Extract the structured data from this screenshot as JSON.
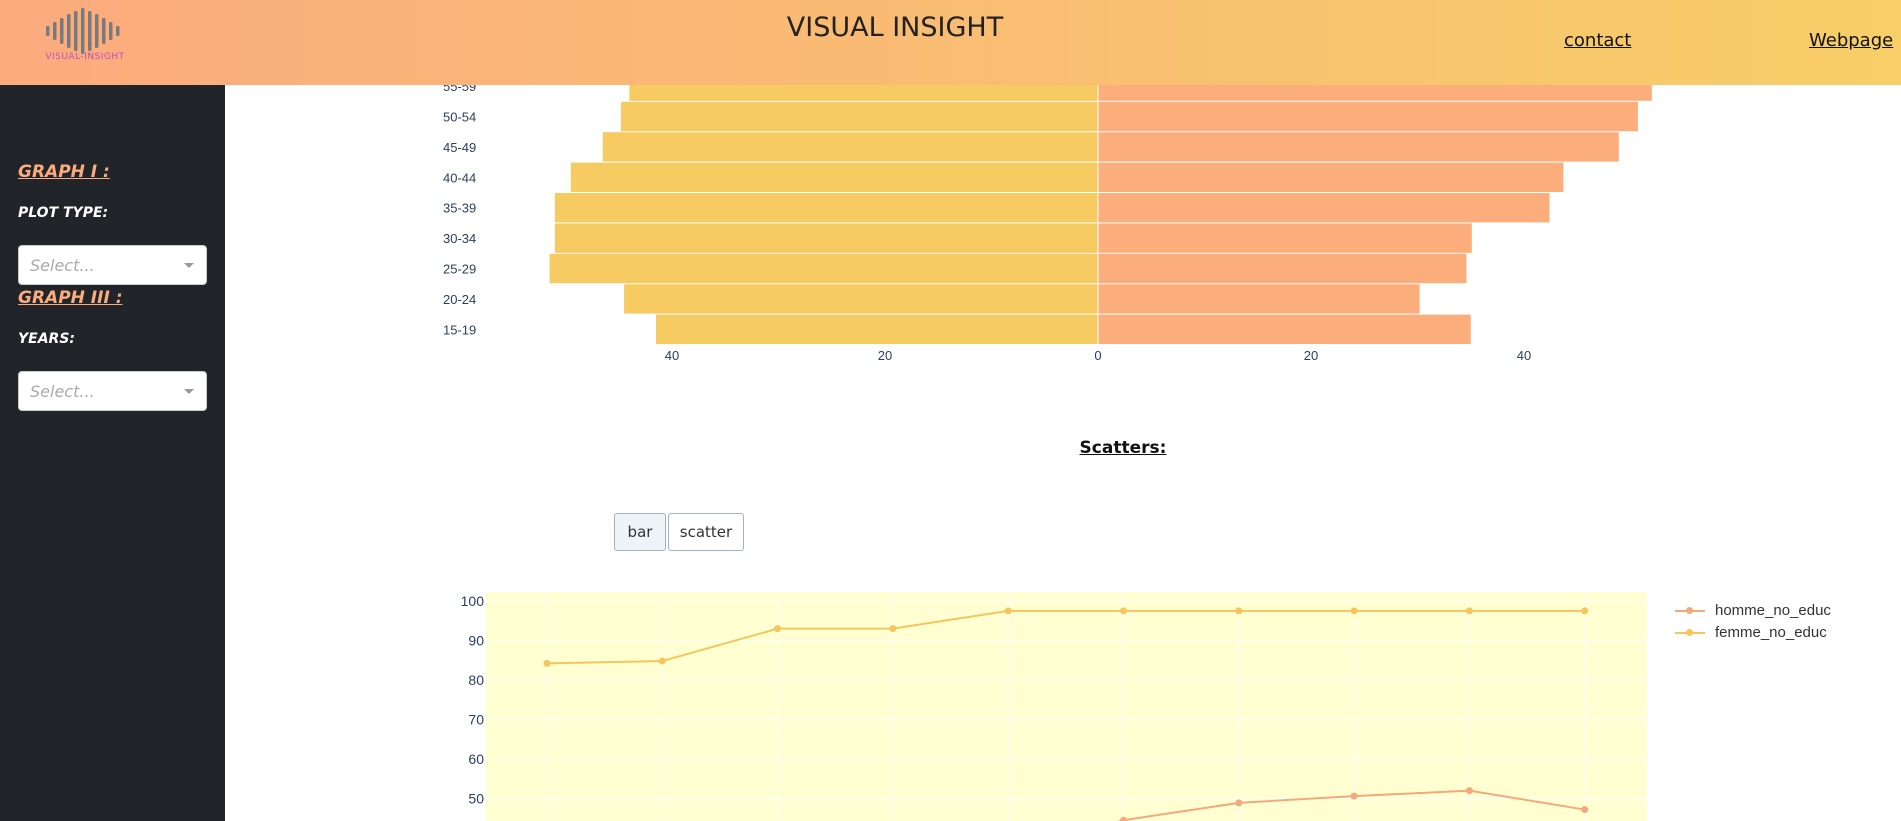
{
  "header": {
    "logo_text": "VISUAL-INSIGHT",
    "title": "VISUAL INSIGHT",
    "nav": {
      "contact": "contact",
      "webpage": "Webpage"
    }
  },
  "sidebar": {
    "graph1": {
      "heading": "GRAPH I :",
      "label": "PLOT TYPE:",
      "placeholder": "Select..."
    },
    "graph3": {
      "heading": "GRAPH III :",
      "label": "YEARS:",
      "placeholder": "Select..."
    }
  },
  "main": {
    "scatter_section_title": "Scatters:",
    "toggle": {
      "bar": "bar",
      "scatter": "scatter",
      "active": "bar"
    }
  },
  "colors": {
    "left": "#f5cb62",
    "right": "#fbae7b",
    "line_homme": "#f4a97a",
    "line_femme": "#f4c65c",
    "plot_bg": "#ffffd2"
  },
  "chart_data": [
    {
      "type": "bar",
      "orientation": "horizontal-population-pyramid",
      "categories": [
        "15-19",
        "20-24",
        "25-29",
        "30-34",
        "35-39",
        "40-44",
        "45-49",
        "50-54",
        "55-59"
      ],
      "series": [
        {
          "side": "left",
          "values": [
            41.5,
            44.5,
            51.5,
            51.0,
            51.0,
            49.5,
            46.5,
            44.8,
            44.0
          ]
        },
        {
          "side": "right",
          "values": [
            35.0,
            30.2,
            34.6,
            35.1,
            42.4,
            43.7,
            48.9,
            50.7,
            52.0
          ]
        }
      ],
      "xticks": [
        40,
        20,
        0,
        20,
        40
      ],
      "xlim_abs": 50
    },
    {
      "type": "line",
      "x": [
        1,
        2,
        3,
        4,
        5,
        6,
        7,
        8,
        9,
        10
      ],
      "series": [
        {
          "name": "homme_no_educ",
          "values": [
            null,
            null,
            null,
            null,
            null,
            44.5,
            48.9,
            50.6,
            52.0,
            47.2
          ]
        },
        {
          "name": "femme_no_educ",
          "values": [
            84.2,
            84.8,
            93.0,
            93.0,
            97.5,
            97.5,
            97.5,
            97.5,
            97.5,
            97.5
          ]
        }
      ],
      "yticks": [
        50,
        60,
        70,
        80,
        90,
        100
      ],
      "ylim": [
        40,
        101
      ],
      "grid": true,
      "legend": "top-right"
    }
  ]
}
